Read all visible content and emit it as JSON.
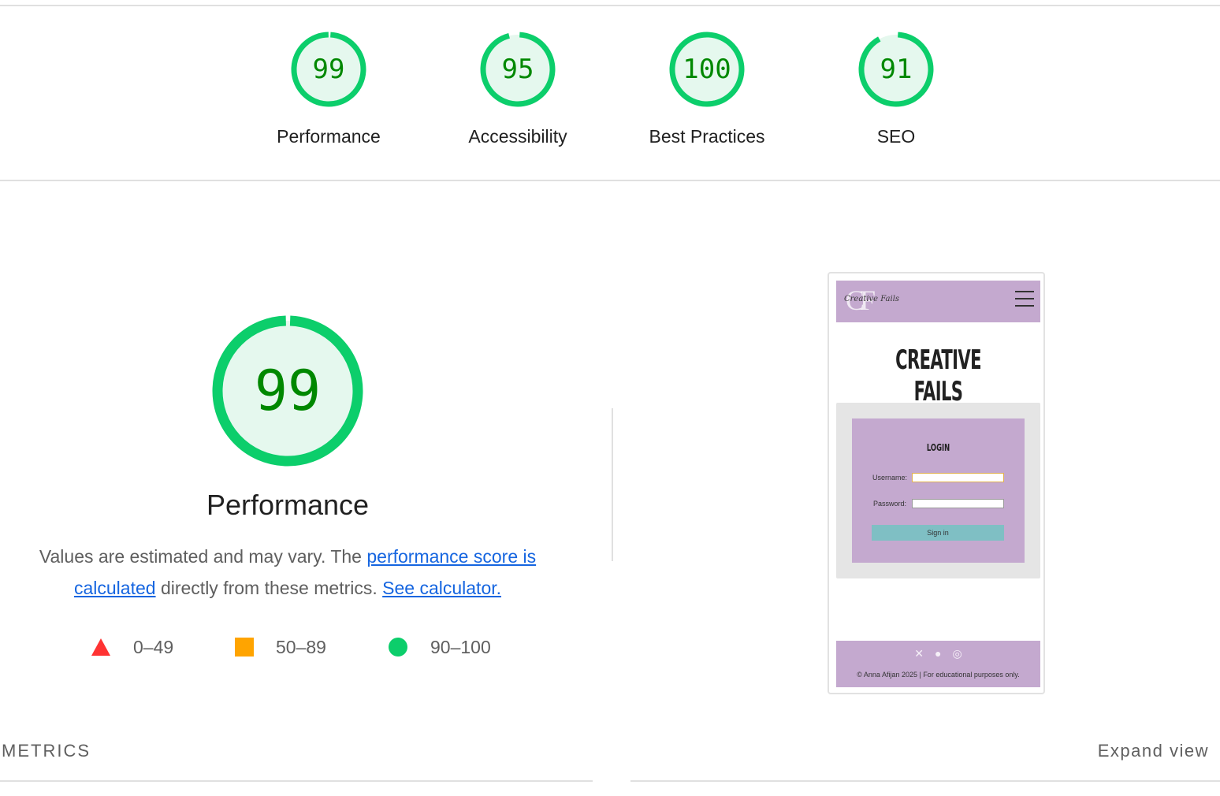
{
  "scores": [
    {
      "label": "Performance",
      "value": "99",
      "score": 0.99
    },
    {
      "label": "Accessibility",
      "value": "95",
      "score": 0.95
    },
    {
      "label": "Best Practices",
      "value": "100",
      "score": 1.0
    },
    {
      "label": "SEO",
      "value": "91",
      "score": 0.91
    }
  ],
  "main": {
    "title": "Performance",
    "value": "99",
    "score": 0.99,
    "desc_text_1": "Values are estimated and may vary. The ",
    "desc_link_1": "performance score is calculated",
    "desc_text_2": " directly from these metrics. ",
    "desc_link_2": "See calculator."
  },
  "legend": {
    "fail": "0–49",
    "average": "50–89",
    "pass": "90–100"
  },
  "screenshot": {
    "logo_mark": "CF",
    "logo_script": "Creative Fails",
    "title": "CREATIVE FAILS",
    "login_heading": "LOGIN",
    "username_label": "Username:",
    "password_label": "Password:",
    "signin_label": "Sign in",
    "social_icons": [
      "x-icon",
      "github-icon",
      "instagram-icon"
    ],
    "copyright": "© Anna Afijan 2025 | For educational purposes only."
  },
  "metrics": {
    "heading": "METRICS",
    "expand_label": "Expand view"
  },
  "colors": {
    "pass": "#0cce6b",
    "pass_fill": "#e5f8ee",
    "pass_text": "#008800",
    "average": "#ffa400",
    "fail": "#ff3333",
    "link": "#1565e0"
  }
}
